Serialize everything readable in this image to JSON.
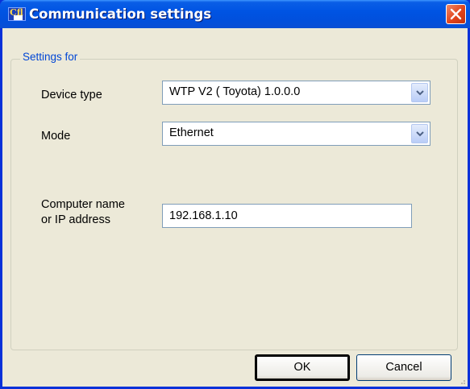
{
  "window": {
    "title": "Communication settings",
    "app_icon_text": "Cfl",
    "close_icon": "close-icon"
  },
  "group": {
    "legend": "Settings for"
  },
  "form": {
    "device_type": {
      "label": "Device type",
      "value": "WTP V2 ( Toyota) 1.0.0.0"
    },
    "mode": {
      "label": "Mode",
      "value": "Ethernet"
    },
    "address": {
      "label_line1": "Computer name",
      "label_line2": "or IP address",
      "value": "192.168.1.10"
    }
  },
  "buttons": {
    "ok": "OK",
    "cancel": "Cancel"
  },
  "colors": {
    "titlebar": "#0054e3",
    "close": "#e2431a",
    "face": "#ece9d8",
    "legend": "#0046d5"
  }
}
